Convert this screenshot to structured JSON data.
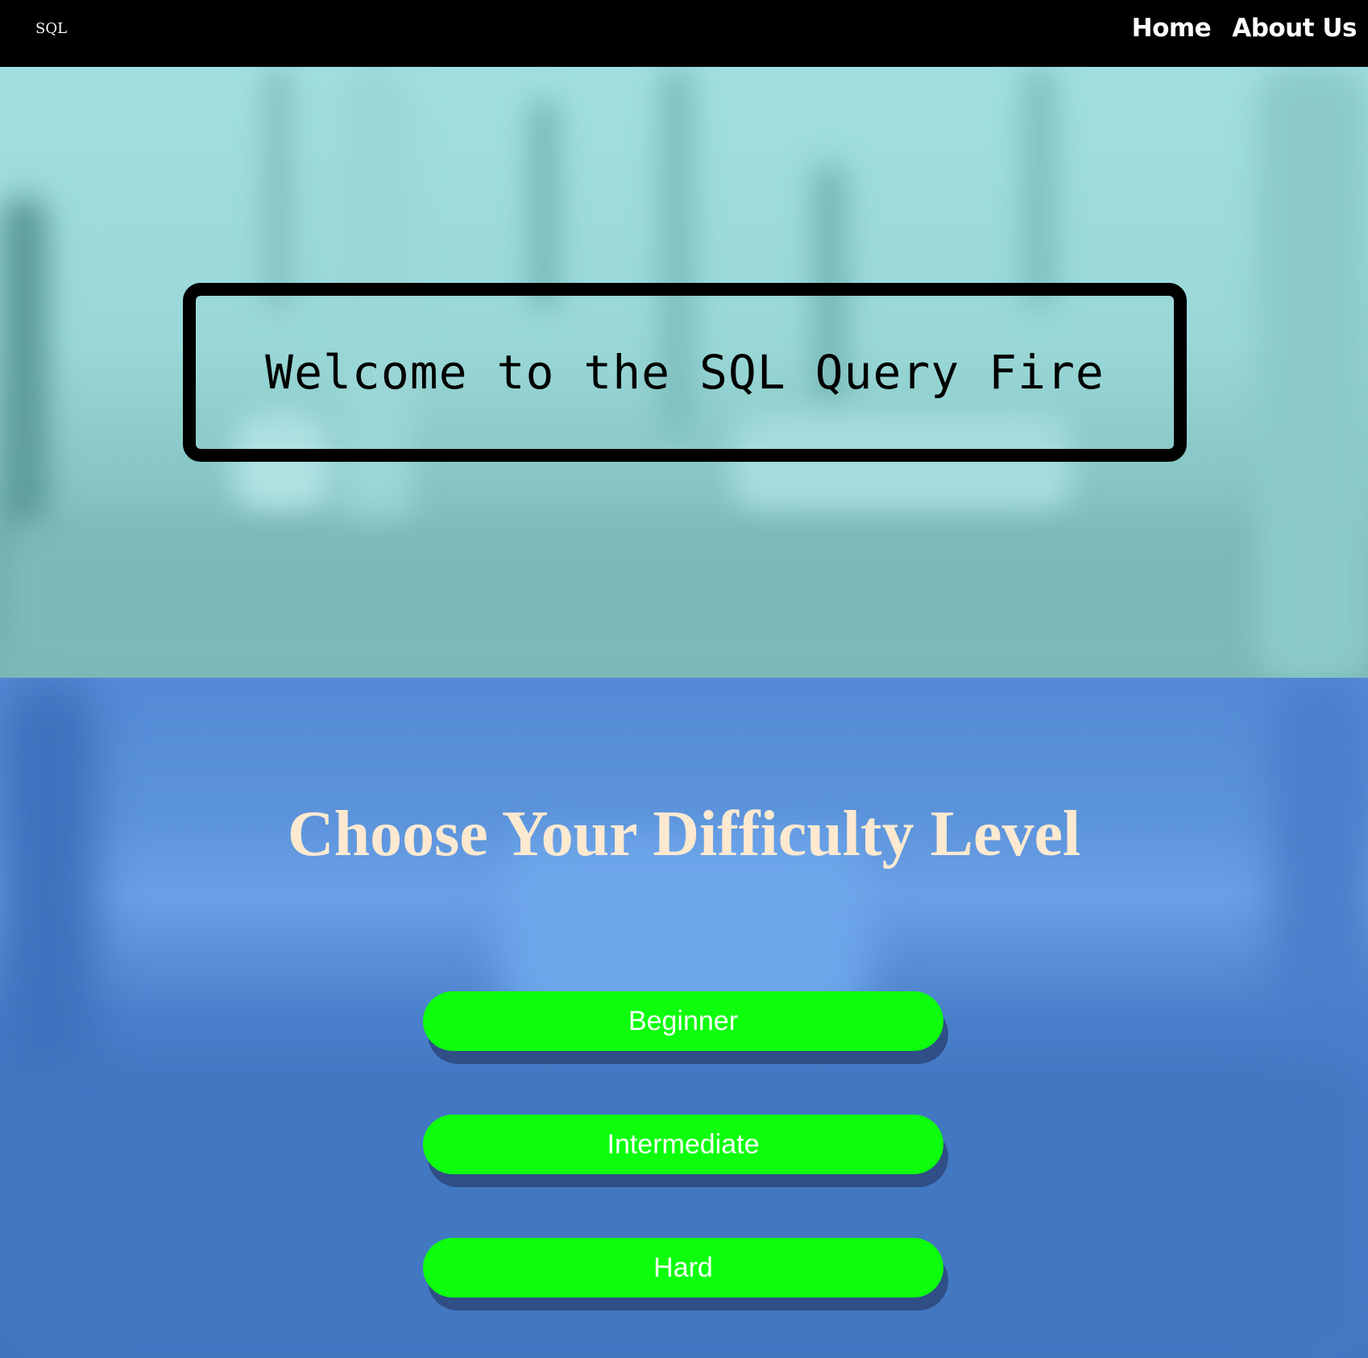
{
  "navbar": {
    "brand": "SQL",
    "links": [
      {
        "label": "Home"
      },
      {
        "label": "About Us"
      }
    ]
  },
  "hero": {
    "welcome_text": "Welcome to the SQL Query Fire"
  },
  "difficulty": {
    "title": "Choose Your Difficulty Level",
    "levels": [
      {
        "label": "Beginner"
      },
      {
        "label": "Intermediate"
      },
      {
        "label": "Hard"
      }
    ]
  },
  "colors": {
    "navbar_bg": "#000000",
    "hero_bg": "#a1dfe0",
    "difficulty_bg": "#4a80cb",
    "title_color": "#fce9d0",
    "button_bg": "#0dff0d",
    "button_shadow": "#2f4f86",
    "button_text": "#ffffff"
  }
}
